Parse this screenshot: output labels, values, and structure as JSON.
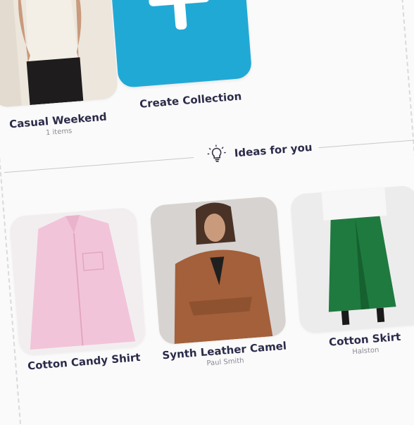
{
  "collections": {
    "items": [
      {
        "title": "Casual Weekend",
        "subtitle": "1 items",
        "image": "tank-top-photo"
      }
    ],
    "create_label": "Create Collection",
    "create_icon": "plus-icon"
  },
  "ideas": {
    "heading": "Ideas for you",
    "icon": "lightbulb-icon",
    "products": [
      {
        "title": "Cotton Candy Shirt",
        "brand": "",
        "image": "pink-shirt-photo"
      },
      {
        "title": "Synth Leather Camel",
        "brand": "Paul Smith",
        "image": "leather-jacket-photo"
      },
      {
        "title": "Cotton Skirt",
        "brand": "Halston",
        "image": "green-skirt-photo"
      }
    ]
  },
  "colors": {
    "accent": "#21a9d6",
    "background": "#fafafa",
    "title_text": "#2b2b4a",
    "muted_text": "#8b8b95"
  }
}
